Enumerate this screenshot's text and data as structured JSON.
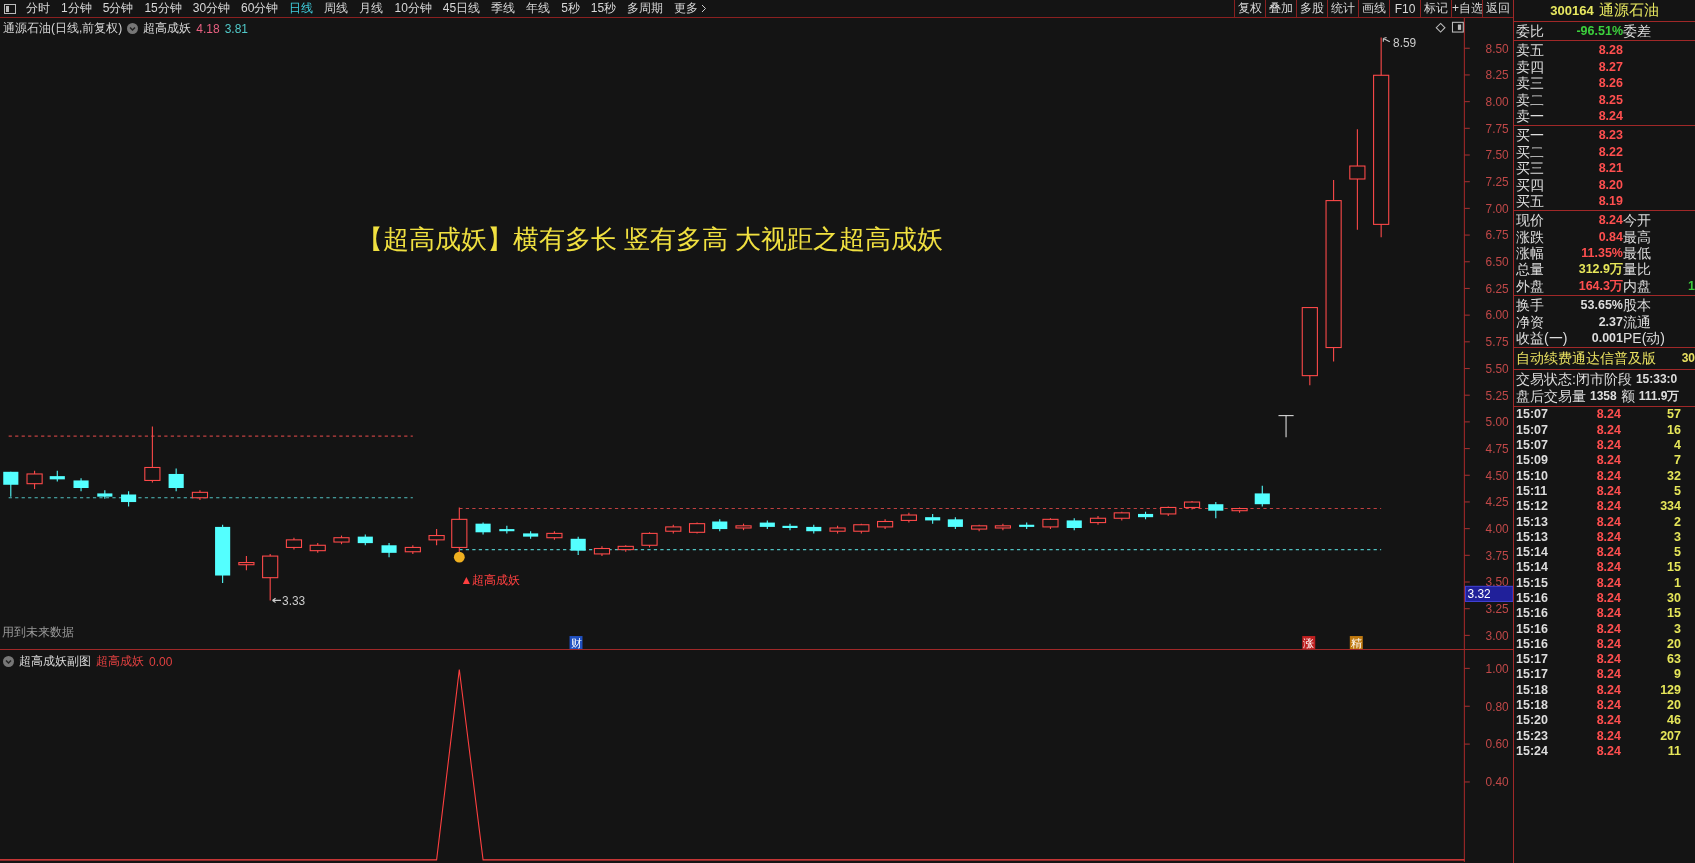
{
  "toolbar": {
    "periods": [
      {
        "label": "分时",
        "selected": false
      },
      {
        "label": "1分钟",
        "selected": false
      },
      {
        "label": "5分钟",
        "selected": false
      },
      {
        "label": "15分钟",
        "selected": false
      },
      {
        "label": "30分钟",
        "selected": false
      },
      {
        "label": "60分钟",
        "selected": false
      },
      {
        "label": "日线",
        "selected": true
      },
      {
        "label": "周线",
        "selected": false
      },
      {
        "label": "月线",
        "selected": false
      },
      {
        "label": "10分钟",
        "selected": false
      },
      {
        "label": "45日线",
        "selected": false
      },
      {
        "label": "季线",
        "selected": false
      },
      {
        "label": "年线",
        "selected": false
      },
      {
        "label": "5秒",
        "selected": false
      },
      {
        "label": "15秒",
        "selected": false
      },
      {
        "label": "多周期",
        "selected": false
      }
    ],
    "more": "更多",
    "buttons": [
      "复权",
      "叠加",
      "多股",
      "统计",
      "画线",
      "F10",
      "标记",
      "+自选",
      "返回"
    ]
  },
  "chart": {
    "title": "通源石油(日线,前复权)",
    "indicator": "超高成妖",
    "value_1": "4.18",
    "value_2": "3.81",
    "headline": "【超高成妖】横有多长 竖有多高 大视距之超高成妖",
    "signal_label": "▲超高成妖",
    "low_label": "3.33",
    "high_label": "8.59",
    "note": "用到未来数据",
    "markers": [
      {
        "text": "财",
        "kind": "finance"
      },
      {
        "text": "涨",
        "kind": "limit"
      },
      {
        "text": "精",
        "kind": "pick"
      }
    ]
  },
  "price_axis": {
    "ticks": [
      "8.50",
      "8.25",
      "8.00",
      "7.75",
      "7.50",
      "7.25",
      "7.00",
      "6.75",
      "6.50",
      "6.25",
      "6.00",
      "5.75",
      "5.50",
      "5.25",
      "5.00",
      "4.75",
      "4.50",
      "4.25",
      "4.00",
      "3.75",
      "3.50",
      "3.25",
      "3.00"
    ],
    "cursor": "3.32"
  },
  "sub_chart": {
    "title": "超高成妖副图",
    "indicator": "超高成妖",
    "value": "0.00",
    "ticks": [
      "1.00",
      "0.80",
      "0.60",
      "0.40"
    ]
  },
  "quote": {
    "code": "300164",
    "name": "通源石油",
    "ratio": {
      "label": "委比",
      "value": "-96.51%",
      "label2": "委差"
    },
    "asks": [
      {
        "label": "卖五",
        "price": "8.28"
      },
      {
        "label": "卖四",
        "price": "8.27"
      },
      {
        "label": "卖三",
        "price": "8.26"
      },
      {
        "label": "卖二",
        "price": "8.25"
      },
      {
        "label": "卖一",
        "price": "8.24"
      }
    ],
    "bids": [
      {
        "label": "买一",
        "price": "8.23"
      },
      {
        "label": "买二",
        "price": "8.22"
      },
      {
        "label": "买三",
        "price": "8.21"
      },
      {
        "label": "买四",
        "price": "8.20"
      },
      {
        "label": "买五",
        "price": "8.19"
      }
    ],
    "stats": [
      {
        "label": "现价",
        "value": "8.24",
        "color": "#ff4f4f",
        "label2": "今开"
      },
      {
        "label": "涨跌",
        "value": "0.84",
        "color": "#ff4f4f",
        "label2": "最高"
      },
      {
        "label": "涨幅",
        "value": "11.35%",
        "color": "#ff4f4f",
        "label2": "最低"
      },
      {
        "label": "总量",
        "value": "312.9万",
        "color": "#e6e65a",
        "label2": "量比"
      },
      {
        "label": "外盘",
        "value": "164.3万",
        "color": "#ff4f4f",
        "label2": "内盘",
        "value2": {
          "text": "1",
          "color": "#3cc83c"
        }
      }
    ],
    "fundamentals": [
      {
        "label": "换手",
        "value": "53.65%",
        "label2": "股本"
      },
      {
        "label": "净资",
        "value": "2.37",
        "label2": "流通"
      },
      {
        "label": "收益(一)",
        "value": "0.001",
        "label2": "PE(动)"
      }
    ],
    "promo": {
      "text": "自动续费通达信普及版",
      "value": "30"
    },
    "status": {
      "label": "交易状态:闭市阶段",
      "time": "15:33:0"
    },
    "after_hours": {
      "label": "盘后交易量",
      "volume": "1358",
      "amount_label": "额",
      "amount": "111.9万"
    },
    "ticks": [
      {
        "time": "15:07",
        "price": "8.24",
        "volume": "57"
      },
      {
        "time": "15:07",
        "price": "8.24",
        "volume": "16"
      },
      {
        "time": "15:07",
        "price": "8.24",
        "volume": "4"
      },
      {
        "time": "15:09",
        "price": "8.24",
        "volume": "7"
      },
      {
        "time": "15:10",
        "price": "8.24",
        "volume": "32"
      },
      {
        "time": "15:11",
        "price": "8.24",
        "volume": "5"
      },
      {
        "time": "15:12",
        "price": "8.24",
        "volume": "334"
      },
      {
        "time": "15:13",
        "price": "8.24",
        "volume": "2"
      },
      {
        "time": "15:13",
        "price": "8.24",
        "volume": "3"
      },
      {
        "time": "15:14",
        "price": "8.24",
        "volume": "5"
      },
      {
        "time": "15:14",
        "price": "8.24",
        "volume": "15"
      },
      {
        "time": "15:15",
        "price": "8.24",
        "volume": "1"
      },
      {
        "time": "15:16",
        "price": "8.24",
        "volume": "30"
      },
      {
        "time": "15:16",
        "price": "8.24",
        "volume": "15"
      },
      {
        "time": "15:16",
        "price": "8.24",
        "volume": "3"
      },
      {
        "time": "15:16",
        "price": "8.24",
        "volume": "20"
      },
      {
        "time": "15:17",
        "price": "8.24",
        "volume": "63"
      },
      {
        "time": "15:17",
        "price": "8.24",
        "volume": "9"
      },
      {
        "time": "15:18",
        "price": "8.24",
        "volume": "129"
      },
      {
        "time": "15:18",
        "price": "8.24",
        "volume": "20"
      },
      {
        "time": "15:20",
        "price": "8.24",
        "volume": "46"
      },
      {
        "time": "15:23",
        "price": "8.24",
        "volume": "207"
      },
      {
        "time": "15:24",
        "price": "8.24",
        "volume": "11"
      }
    ]
  }
}
